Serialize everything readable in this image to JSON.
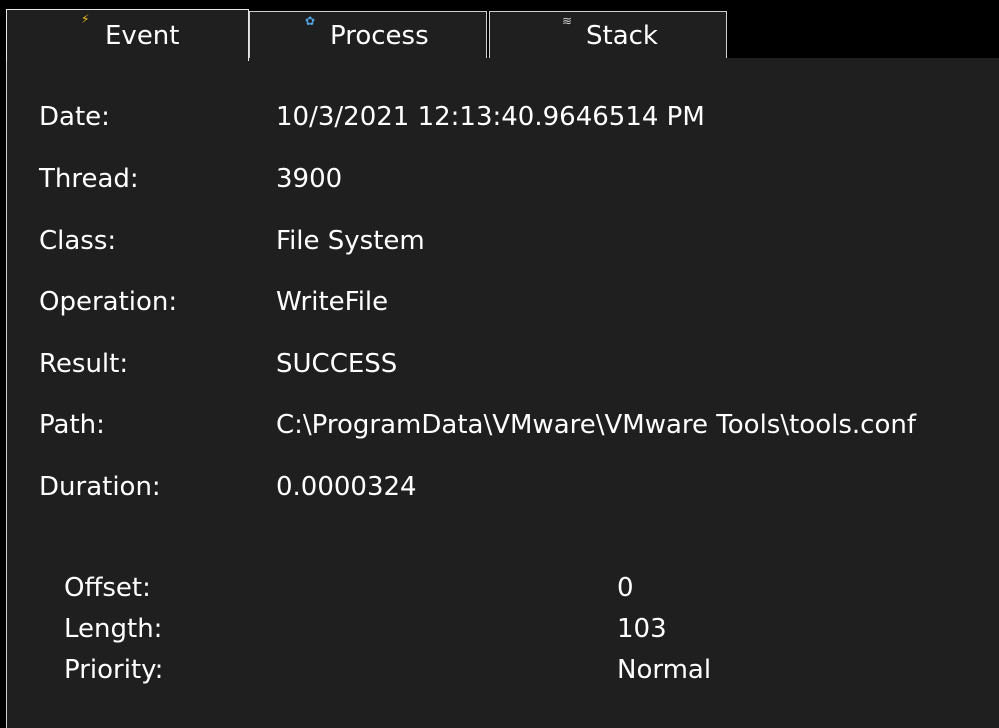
{
  "tabs": [
    {
      "label": "Event",
      "icon": "lightning-icon",
      "icon_glyph": "⚡",
      "icon_color": "#f2c21b",
      "selected": true
    },
    {
      "label": "Process",
      "icon": "gear-icon",
      "icon_glyph": "✿",
      "icon_color": "#4fa3e0",
      "selected": false
    },
    {
      "label": "Stack",
      "icon": "layers-icon",
      "icon_glyph": "≋",
      "icon_color": "#cfcfcf",
      "selected": false
    }
  ],
  "event": {
    "fields": [
      {
        "label": "Date:",
        "value": "10/3/2021 12:13:40.9646514 PM"
      },
      {
        "label": "Thread:",
        "value": "3900"
      },
      {
        "label": "Class:",
        "value": "File System"
      },
      {
        "label": "Operation:",
        "value": "WriteFile"
      },
      {
        "label": "Result:",
        "value": "SUCCESS"
      },
      {
        "label": "Path:",
        "value": "C:\\ProgramData\\VMware\\VMware Tools\\tools.conf"
      },
      {
        "label": "Duration:",
        "value": "0.0000324"
      }
    ],
    "details": [
      {
        "label": "Offset:",
        "value": "0"
      },
      {
        "label": "Length:",
        "value": "103"
      },
      {
        "label": "Priority:",
        "value": "Normal"
      }
    ]
  },
  "colors": {
    "background": "#1f1f1f",
    "text": "#ffffff",
    "border": "#cfcfcf"
  }
}
